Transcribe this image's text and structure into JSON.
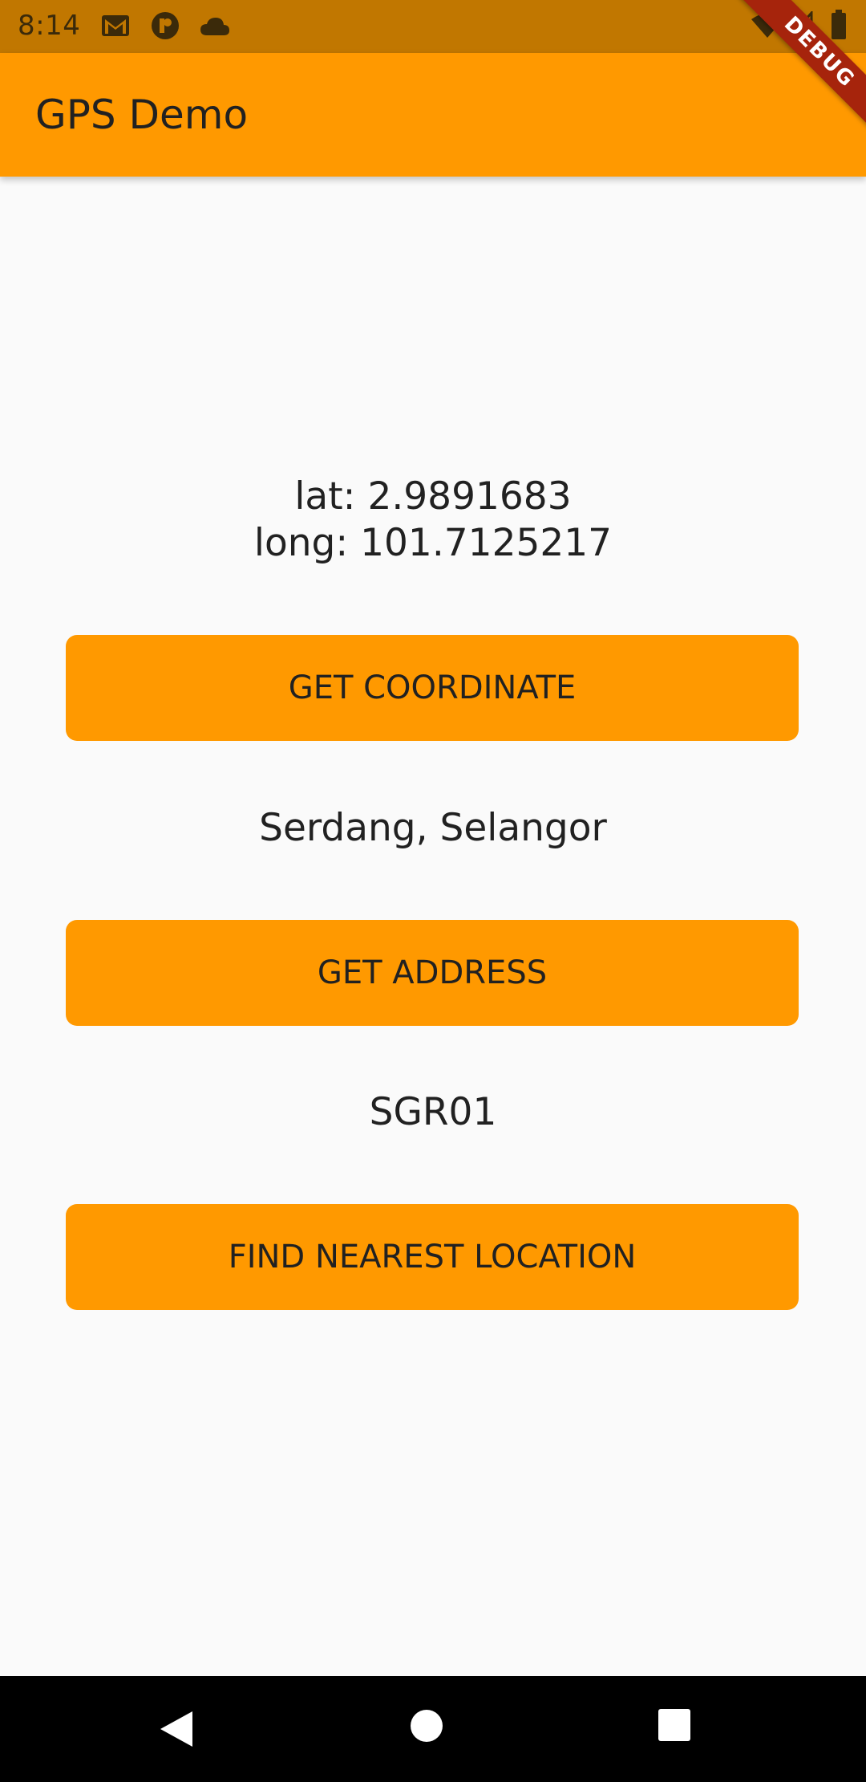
{
  "status_bar": {
    "time": "8:14",
    "icons": [
      "gmail-icon",
      "app-notification-icon",
      "cloud-icon",
      "wifi-icon",
      "signal-icon",
      "battery-icon"
    ]
  },
  "debug_banner": {
    "label": "DEBUG"
  },
  "app_bar": {
    "title": "GPS Demo",
    "color": "#ff9900"
  },
  "coordinates": {
    "lat_text": "lat: 2.9891683",
    "long_text": "long: 101.7125217"
  },
  "buttons": {
    "get_coordinate": "GET COORDINATE",
    "get_address": "GET ADDRESS",
    "find_nearest": "FIND NEAREST LOCATION"
  },
  "address": {
    "text": "Serdang, Selangor"
  },
  "nearest_location": {
    "text": "SGR01"
  },
  "nav_bar": {
    "icons": [
      "back-icon",
      "home-icon",
      "recents-icon"
    ]
  },
  "colors": {
    "accent": "#ff9900",
    "status_bar": "#c17700",
    "background": "#fafafa",
    "debug_banner": "#a6240c"
  }
}
